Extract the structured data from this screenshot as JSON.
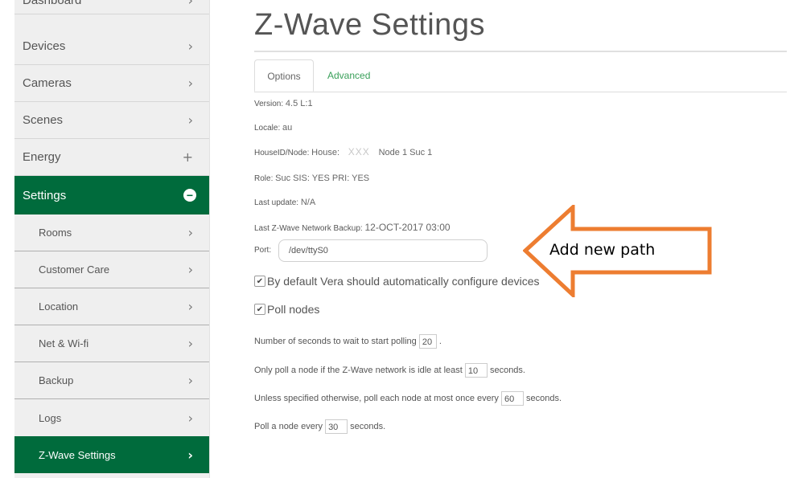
{
  "sidebar": {
    "items": [
      {
        "label": "Dashboard",
        "icon": "chevron-right-icon"
      },
      {
        "label": "Devices",
        "icon": "chevron-right-icon"
      },
      {
        "label": "Cameras",
        "icon": "chevron-right-icon"
      },
      {
        "label": "Scenes",
        "icon": "chevron-right-icon"
      },
      {
        "label": "Energy",
        "icon": "plus-icon"
      },
      {
        "label": "Settings",
        "icon": "minus-circle-icon"
      }
    ],
    "subitems": [
      {
        "label": "Rooms"
      },
      {
        "label": "Customer Care"
      },
      {
        "label": "Location"
      },
      {
        "label": "Net & Wi-fi"
      },
      {
        "label": "Backup"
      },
      {
        "label": "Logs"
      },
      {
        "label": "Z-Wave Settings"
      }
    ],
    "chevron": "›",
    "plus": "+",
    "minus": "−"
  },
  "main": {
    "title": "Z-Wave Settings",
    "tabs": [
      {
        "label": "Options",
        "active": true
      },
      {
        "label": "Advanced",
        "active": false
      }
    ],
    "info": {
      "version_label": "Version:",
      "version_value": "4.5 L:1",
      "locale_label": "Locale:",
      "locale_value": "au",
      "houseid_label": "HouseID/Node:",
      "houseid_house": "House:",
      "houseid_masked": "XXX",
      "houseid_node": "Node 1 Suc 1",
      "role_label": "Role:",
      "role_value": "Suc SIS: YES PRI: YES",
      "last_update_label": "Last update:",
      "last_update_value": "N/A",
      "backup_label": "Last Z-Wave Network Backup:",
      "backup_value": "12-OCT-2017 03:00",
      "port_label": "Port:",
      "port_value": "/dev/ttyS0"
    },
    "checkboxes": [
      {
        "label": "By default Vera should automatically configure devices",
        "checked": true
      },
      {
        "label": "Poll nodes",
        "checked": true
      }
    ],
    "check_glyph": "✔",
    "polling": {
      "wait_prefix": "Number of seconds to wait to start polling",
      "wait_value": "20",
      "wait_suffix": ".",
      "idle_prefix": "Only poll a node if the Z-Wave network is idle at least",
      "idle_value": "10",
      "idle_suffix": "seconds.",
      "once_prefix": "Unless specified otherwise, poll each node at most once every",
      "once_value": "60",
      "once_suffix": "seconds.",
      "every_prefix": "Poll a node every",
      "every_value": "30",
      "every_suffix": "seconds."
    }
  },
  "annotation": {
    "text": "Add new path",
    "color": "#ed7d31"
  },
  "colors": {
    "accent_green": "#006b3c",
    "tab_link_green": "#3aa05a"
  }
}
